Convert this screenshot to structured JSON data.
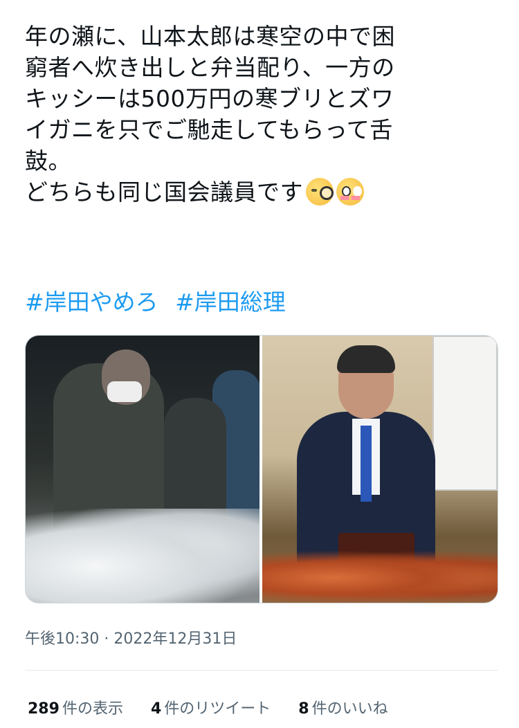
{
  "tweet": {
    "text_lines": [
      "年の瀬に、山本太郎は寒空の中で困",
      "窮者へ炊き出しと弁当配り、一方の",
      "キッシーは500万円の寒ブリとズワ",
      "イガニを只でご馳走してもらって舌",
      "鼓。",
      "どちらも同じ国会議員です"
    ],
    "emojis": [
      "face-with-monocle",
      "flushed-face"
    ],
    "hashtags": [
      "#岸田やめろ",
      "#岸田総理"
    ],
    "timestamp": "午後10:30 · 2022年12月31日"
  },
  "stats": {
    "views_count": "289",
    "views_label": "件の表示",
    "retweets_count": "4",
    "retweets_label": "件のリツイート",
    "likes_count": "8",
    "likes_label": "件のいいね"
  },
  "colors": {
    "hashtag": "#1d9bf0",
    "text": "#0f1419",
    "meta": "#536471"
  }
}
